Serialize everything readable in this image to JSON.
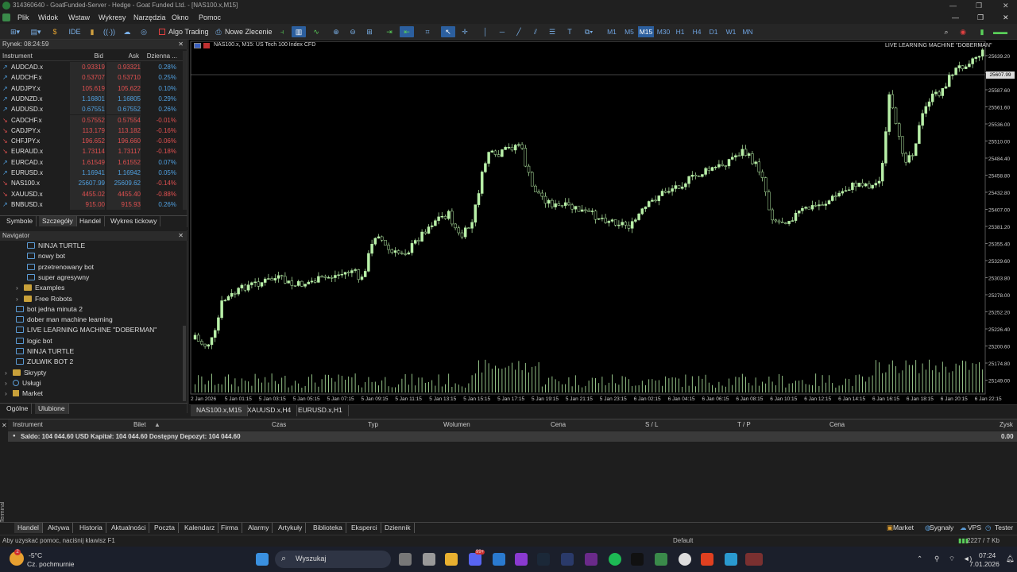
{
  "window": {
    "title": "314360640 - GoatFunded-Server - Hedge - Goat Funded Ltd. - [NAS100.x,M15]",
    "minimize": "—",
    "maximize": "❐",
    "close": "✕"
  },
  "menu": [
    "Plik",
    "Widok",
    "Wstaw",
    "Wykresy",
    "Narzędzia",
    "Okno",
    "Pomoc"
  ],
  "toolbar": {
    "algo_trading": "Algo Trading",
    "new_order": "Nowe Zlecenie",
    "timeframes": [
      "M1",
      "M5",
      "M15",
      "M30",
      "H1",
      "H4",
      "D1",
      "W1",
      "MN"
    ],
    "active_timeframe": "M15"
  },
  "market": {
    "title": "Rynek: 08:24:59",
    "columns": [
      "Instrument",
      "Bid",
      "Ask",
      "Dzienna ..."
    ],
    "rows": [
      {
        "sym": "AUDCAD.x",
        "bid": "0.93319",
        "ask": "0.93321",
        "chg": "0.28%",
        "dir": "up"
      },
      {
        "sym": "AUDCHF.x",
        "bid": "0.53707",
        "ask": "0.53710",
        "chg": "0.25%",
        "dir": "up"
      },
      {
        "sym": "AUDJPY.x",
        "bid": "105.619",
        "ask": "105.622",
        "chg": "0.10%",
        "dir": "up"
      },
      {
        "sym": "AUDNZD.x",
        "bid": "1.16801",
        "ask": "1.16805",
        "chg": "0.29%",
        "dir": "up"
      },
      {
        "sym": "AUDUSD.x",
        "bid": "0.67551",
        "ask": "0.67552",
        "chg": "0.26%",
        "dir": "up"
      },
      {
        "sym": "CADCHF.x",
        "bid": "0.57552",
        "ask": "0.57554",
        "chg": "-0.01%",
        "dir": "down"
      },
      {
        "sym": "CADJPY.x",
        "bid": "113.179",
        "ask": "113.182",
        "chg": "-0.16%",
        "dir": "down"
      },
      {
        "sym": "CHFJPY.x",
        "bid": "196.652",
        "ask": "196.660",
        "chg": "-0.06%",
        "dir": "down"
      },
      {
        "sym": "EURAUD.x",
        "bid": "1.73114",
        "ask": "1.73117",
        "chg": "-0.18%",
        "dir": "down"
      },
      {
        "sym": "EURCAD.x",
        "bid": "1.61549",
        "ask": "1.61552",
        "chg": "0.07%",
        "dir": "up"
      },
      {
        "sym": "EURUSD.x",
        "bid": "1.16941",
        "ask": "1.16942",
        "chg": "0.05%",
        "dir": "up"
      },
      {
        "sym": "NAS100.x",
        "bid": "25607.99",
        "ask": "25609.62",
        "chg": "-0.14%",
        "dir": "down"
      },
      {
        "sym": "XAUUSD.x",
        "bid": "4455.02",
        "ask": "4455.40",
        "chg": "-0.88%",
        "dir": "down"
      },
      {
        "sym": "BNBUSD.x",
        "bid": "915.00",
        "ask": "915.93",
        "chg": "0.26%",
        "dir": "up"
      }
    ],
    "tabs": [
      "Symbole",
      "Szczegóły",
      "Handel",
      "Wykres tickowy"
    ]
  },
  "navigator": {
    "title": "Navigator",
    "items": [
      {
        "label": "NINJA TURTLE",
        "type": "ea",
        "indent": 2
      },
      {
        "label": "nowy bot",
        "type": "ea",
        "indent": 2
      },
      {
        "label": "przetrenowany bot",
        "type": "ea",
        "indent": 2
      },
      {
        "label": "super agresywny",
        "type": "ea",
        "indent": 2
      },
      {
        "label": "Examples",
        "type": "folder",
        "indent": 1
      },
      {
        "label": "Free Robots",
        "type": "folder",
        "indent": 1
      },
      {
        "label": "bot jedna minuta 2",
        "type": "ea",
        "indent": 1
      },
      {
        "label": "dober man machine learning",
        "type": "ea",
        "indent": 1
      },
      {
        "label": "LIVE LEARNING MACHINE \"DOBERMAN\"",
        "type": "ea",
        "indent": 1
      },
      {
        "label": "logic bot",
        "type": "ea",
        "indent": 1
      },
      {
        "label": "NINJA TURTLE",
        "type": "ea",
        "indent": 1
      },
      {
        "label": "ZULWIK BOT 2",
        "type": "ea",
        "indent": 1
      },
      {
        "label": "Skrypty",
        "type": "folder",
        "indent": 0
      },
      {
        "label": "Usługi",
        "type": "service",
        "indent": 0
      },
      {
        "label": "Market",
        "type": "market",
        "indent": 0
      }
    ],
    "tabs": [
      "Ogólne",
      "Ulubione"
    ]
  },
  "chart": {
    "symbol_label": "NAS100.x, M15:  US Tech 100 Index CFD",
    "ea_label": "LIVE LEARNING MACHINE \"DOBERMAN\"",
    "current_price_label": "25607.99",
    "candle_color": "#b8f0a8",
    "price_ticks": [
      "25639.20",
      "25613.60",
      "25587.60",
      "25561.60",
      "25536.00",
      "25510.00",
      "25484.40",
      "25458.80",
      "25432.80",
      "25407.00",
      "25381.20",
      "25355.40",
      "25329.60",
      "25303.80",
      "25278.00",
      "25252.20",
      "25226.40",
      "25200.60",
      "25174.80",
      "25149.00"
    ],
    "time_ticks": [
      "2 Jan 2026",
      "5 Jan 01:15",
      "5 Jan 03:15",
      "5 Jan 05:15",
      "5 Jan 07:15",
      "5 Jan 09:15",
      "5 Jan 11:15",
      "5 Jan 13:15",
      "5 Jan 15:15",
      "5 Jan 17:15",
      "5 Jan 19:15",
      "5 Jan 21:15",
      "5 Jan 23:15",
      "6 Jan 02:15",
      "6 Jan 04:15",
      "6 Jan 06:15",
      "6 Jan 08:15",
      "6 Jan 10:15",
      "6 Jan 12:15",
      "6 Jan 14:15",
      "6 Jan 16:15",
      "6 Jan 18:15",
      "6 Jan 20:15",
      "6 Jan 22:15"
    ],
    "tabs": [
      "NAS100.x,M15",
      "XAUUSD.x,H4",
      "EURUSD.x,H1"
    ]
  },
  "terminal": {
    "columns": [
      "Instrument",
      "Bilet",
      "Czas",
      "Typ",
      "Wolumen",
      "Cena",
      "S / L",
      "T / P",
      "Cena",
      "Zysk"
    ],
    "balance_text": "Saldo: 104 044.60 USD  Kapitał: 104 044.60  Dostępny Depozyt: 104 044.60",
    "profit": "0.00",
    "side_label": "Terminal",
    "tabs": [
      "Handel",
      "Aktywa",
      "Historia",
      "Aktualności",
      "Poczta",
      "Kalendarz",
      "Firma",
      "Alarmy",
      "Artykuły",
      "Biblioteka",
      "Eksperci",
      "Dziennik"
    ],
    "right_links": [
      "Market",
      "Sygnały",
      "VPS",
      "Tester"
    ]
  },
  "status": {
    "help": "Aby uzyskać pomoc, naciśnij klawisz F1",
    "profile": "Default",
    "traffic": "2227 / 7 Kb"
  },
  "taskbar": {
    "temp": "-5°C",
    "weather": "Cz. pochmurnie",
    "search": "Wyszukaj",
    "time": "07:24",
    "date": "7.01.2026",
    "badge": "99+"
  }
}
